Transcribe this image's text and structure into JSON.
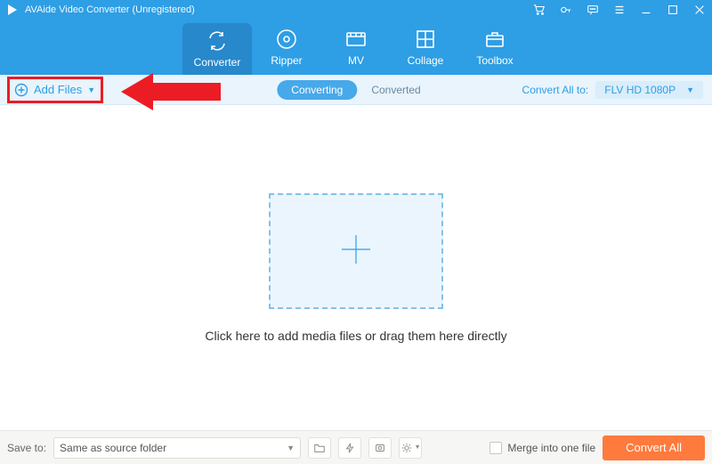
{
  "title": "AVAide Video Converter (Unregistered)",
  "nav": {
    "items": [
      {
        "label": "Converter"
      },
      {
        "label": "Ripper"
      },
      {
        "label": "MV"
      },
      {
        "label": "Collage"
      },
      {
        "label": "Toolbox"
      }
    ]
  },
  "toolbar": {
    "add_files": "Add Files",
    "seg_converting": "Converting",
    "seg_converted": "Converted",
    "convert_all_to": "Convert All to:",
    "format": "FLV HD 1080P"
  },
  "drop": {
    "text": "Click here to add media files or drag them here directly"
  },
  "footer": {
    "save_to_label": "Save to:",
    "save_to_value": "Same as source folder",
    "merge_label": "Merge into one file",
    "convert_all": "Convert All"
  }
}
